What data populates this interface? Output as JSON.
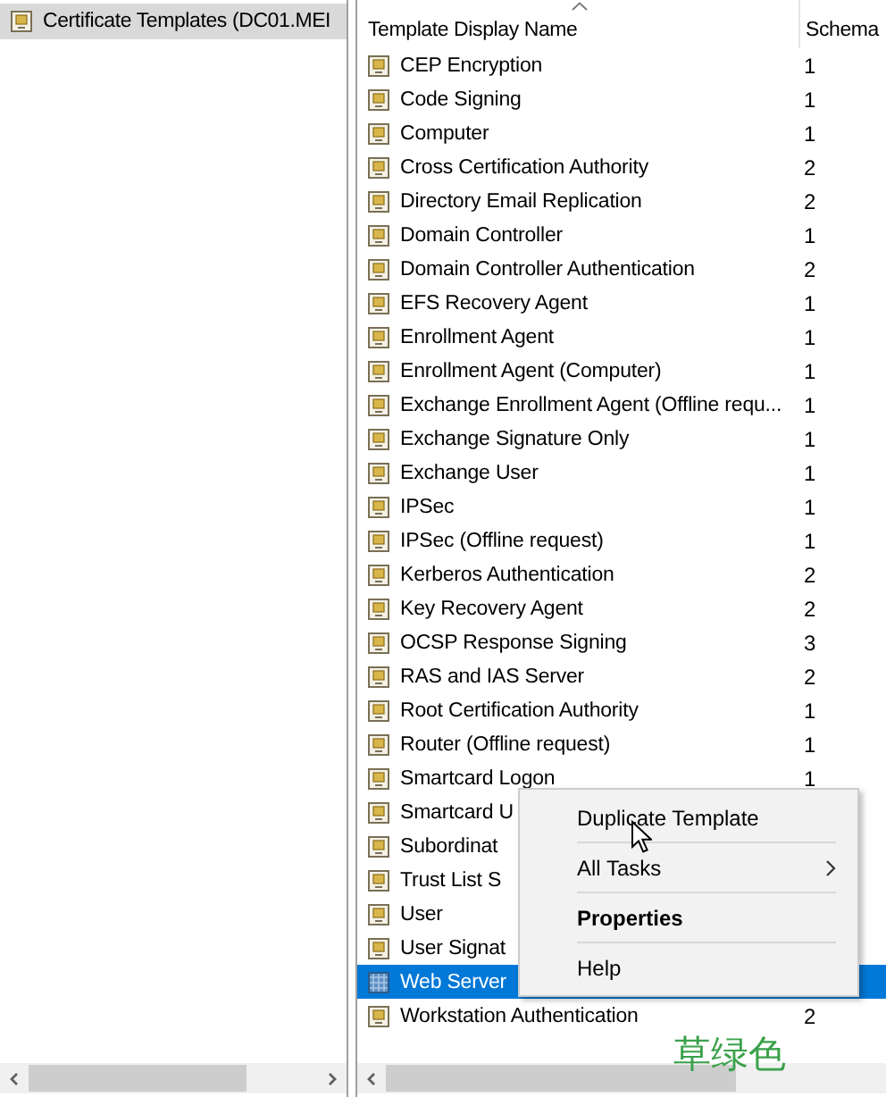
{
  "tree": {
    "items": [
      {
        "label": "Certificate Templates (DC01.MEI",
        "selected": true
      }
    ]
  },
  "list": {
    "columns": [
      {
        "label": "Template Display Name",
        "sorted": true
      },
      {
        "label": "Schema",
        "sorted": false
      }
    ],
    "rows": [
      {
        "name": "CEP Encryption",
        "schema": "1",
        "selected": false
      },
      {
        "name": "Code Signing",
        "schema": "1",
        "selected": false
      },
      {
        "name": "Computer",
        "schema": "1",
        "selected": false
      },
      {
        "name": "Cross Certification Authority",
        "schema": "2",
        "selected": false
      },
      {
        "name": "Directory Email Replication",
        "schema": "2",
        "selected": false
      },
      {
        "name": "Domain Controller",
        "schema": "1",
        "selected": false
      },
      {
        "name": "Domain Controller Authentication",
        "schema": "2",
        "selected": false
      },
      {
        "name": "EFS Recovery Agent",
        "schema": "1",
        "selected": false
      },
      {
        "name": "Enrollment Agent",
        "schema": "1",
        "selected": false
      },
      {
        "name": "Enrollment Agent (Computer)",
        "schema": "1",
        "selected": false
      },
      {
        "name": "Exchange Enrollment Agent (Offline requ...",
        "schema": "1",
        "selected": false
      },
      {
        "name": "Exchange Signature Only",
        "schema": "1",
        "selected": false
      },
      {
        "name": "Exchange User",
        "schema": "1",
        "selected": false
      },
      {
        "name": "IPSec",
        "schema": "1",
        "selected": false
      },
      {
        "name": "IPSec (Offline request)",
        "schema": "1",
        "selected": false
      },
      {
        "name": "Kerberos Authentication",
        "schema": "2",
        "selected": false
      },
      {
        "name": "Key Recovery Agent",
        "schema": "2",
        "selected": false
      },
      {
        "name": "OCSP Response Signing",
        "schema": "3",
        "selected": false
      },
      {
        "name": "RAS and IAS Server",
        "schema": "2",
        "selected": false
      },
      {
        "name": "Root Certification Authority",
        "schema": "1",
        "selected": false
      },
      {
        "name": "Router (Offline request)",
        "schema": "1",
        "selected": false
      },
      {
        "name": "Smartcard Logon",
        "schema": "1",
        "selected": false
      },
      {
        "name": "Smartcard U",
        "selected": false
      },
      {
        "name": "Subordinat",
        "selected": false
      },
      {
        "name": "Trust List S",
        "selected": false
      },
      {
        "name": "User",
        "selected": false
      },
      {
        "name": "User Signat",
        "selected": false
      },
      {
        "name": "Web Server",
        "selected": true
      },
      {
        "name": "Workstation Authentication",
        "schema": "2",
        "selected": false
      }
    ]
  },
  "context_menu": {
    "items": [
      {
        "label": "Duplicate Template",
        "kind": "item",
        "default": false
      },
      {
        "label": "All Tasks",
        "kind": "submenu",
        "default": false
      },
      {
        "label": "Properties",
        "kind": "item",
        "default": true
      },
      {
        "label": "Help",
        "kind": "item",
        "default": false
      }
    ]
  },
  "annotation": "草绿色"
}
